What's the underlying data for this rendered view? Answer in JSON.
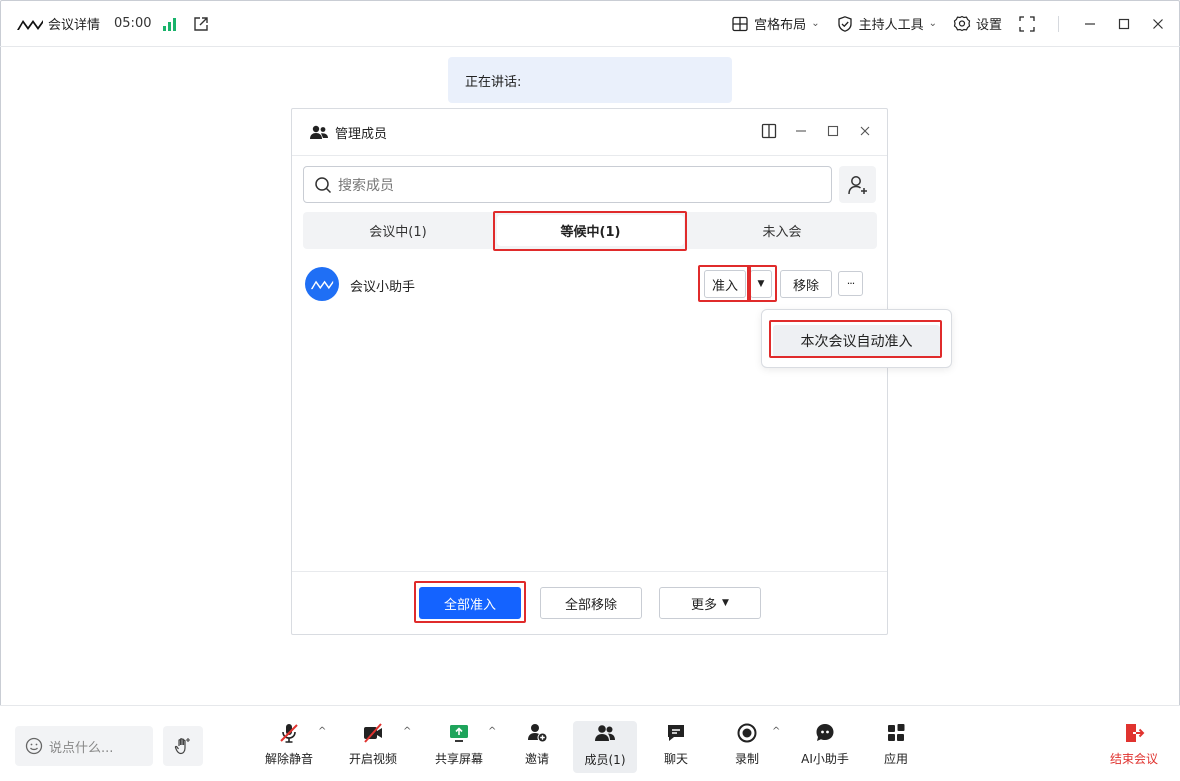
{
  "topbar": {
    "title": "会议详情",
    "time": "05:00",
    "layout_label": "宫格布局",
    "host_tools_label": "主持人工具",
    "settings_label": "设置"
  },
  "speaking": {
    "label": "正在讲话:"
  },
  "dialog": {
    "title": "管理成员",
    "search_placeholder": "搜索成员",
    "tabs": [
      {
        "label": "会议中(1)"
      },
      {
        "label": "等候中(1)",
        "active": true
      },
      {
        "label": "未入会"
      }
    ],
    "member": {
      "name": "会议小助手",
      "admit_label": "准入",
      "remove_label": "移除",
      "more_label": "···"
    },
    "popup_item": "本次会议自动准入",
    "footer": {
      "admit_all": "全部准入",
      "remove_all": "全部移除",
      "more": "更多"
    }
  },
  "bottombar": {
    "chat_placeholder": "说点什么...",
    "tools": [
      {
        "label": "解除静音",
        "icon": "mic-muted-icon"
      },
      {
        "label": "开启视频",
        "icon": "video-off-icon"
      },
      {
        "label": "共享屏幕",
        "icon": "share-screen-icon"
      },
      {
        "label": "邀请",
        "icon": "invite-icon"
      },
      {
        "label": "成员(1)",
        "icon": "members-icon"
      },
      {
        "label": "聊天",
        "icon": "chat-icon"
      },
      {
        "label": "录制",
        "icon": "record-icon"
      },
      {
        "label": "AI小助手",
        "icon": "ai-assistant-icon"
      },
      {
        "label": "应用",
        "icon": "apps-icon"
      }
    ],
    "end_label": "结束会议"
  },
  "colors": {
    "accent": "#1463ff",
    "highlight_border": "#e02b2b",
    "end_red": "#e0332f",
    "signal_green": "#19b36b"
  }
}
